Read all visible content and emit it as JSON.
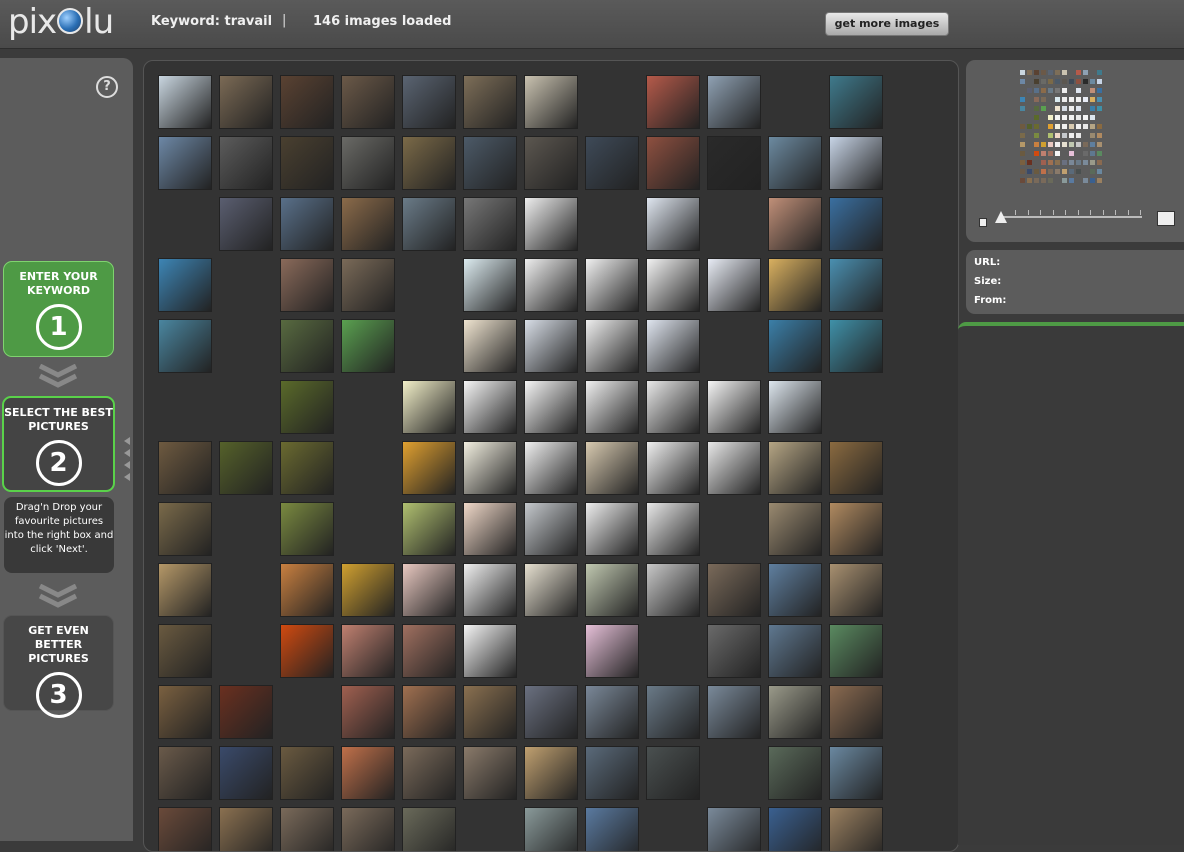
{
  "header": {
    "logo_left": "pix",
    "logo_right": "lu",
    "keyword_label": "Keyword: travail",
    "separator": "|",
    "count_label": "146 images loaded",
    "more_button": "get more images"
  },
  "sidebar": {
    "help": "?",
    "step1": {
      "label": "ENTER YOUR KEYWORD",
      "num": "1"
    },
    "step2": {
      "label": "SELECT THE BEST PICTURES",
      "num": "2"
    },
    "info": "Drag'n Drop your favourite pictures into the right box and click 'Next'.",
    "step3": {
      "label": "GET EVEN BETTER PICTURES",
      "num": "3"
    }
  },
  "details": {
    "url_label": "URL:",
    "size_label": "Size:",
    "from_label": "From:"
  },
  "colors": {
    "accent_green": "#4e9a45",
    "step_border": "#5ad24a"
  },
  "thumbnails": [
    [
      "#c9d6e0",
      "#7b6a55",
      "#5a4232",
      "#6b5948",
      "#5a6472",
      "#7d6e58",
      "#c9c2b0",
      "",
      "#b55a4a",
      "#8fa1b3",
      "",
      "#3f7a8c"
    ],
    [
      "#6d88a6",
      "#5c5c5c",
      "#4a4030",
      "#6a6a66",
      "#7b6a48",
      "#4c5a68",
      "#5c5750",
      "#3e4a58",
      "#8e5040",
      "#2a2a2a",
      "#6c8aa0",
      "#c7d4e6"
    ],
    [
      "",
      "#5a5e70",
      "#59708a",
      "#8b6b4a",
      "#6a7b88",
      "#777",
      "#eee",
      "",
      "#dfe6f0",
      "",
      "#c08f78",
      "#3a6fa0"
    ],
    [
      "#3d85b5",
      "",
      "#8a6a5a",
      "#7a6a58",
      "",
      "#dcebf0",
      "#eee",
      "#f0f0f0",
      "#f2f2f2",
      "#e8ecf5",
      "#d9b060",
      "#4a8fb0"
    ],
    [
      "#4a86a0",
      "",
      "#586a40",
      "#5aa050",
      "",
      "#efe4d0",
      "#d7dde6",
      "#eee",
      "#dfe5ef",
      "",
      "#3b7fa8",
      "#3f90a8"
    ],
    [
      "",
      "",
      "#5a6a2a",
      "",
      "#f2efc8",
      "#f5f5f5",
      "#f5f5f5",
      "#f0f0f0",
      "#e8e8e8",
      "#f5f5f5",
      "#dde6ee",
      ""
    ],
    [
      "#6e5a40",
      "#55612a",
      "#6a6a30",
      "",
      "#e0a030",
      "#f2efe0",
      "#f0f0f0",
      "#d8cab0",
      "#f0f0f0",
      "#e8e8e8",
      "#b5a584",
      "#8a6a40"
    ],
    [
      "#7a6a4a",
      "",
      "#7a8a40",
      "",
      "#b0c070",
      "#f0d8c8",
      "#c4c8cc",
      "#eee",
      "#e8e8e8",
      "",
      "#9a8a70",
      "#b08a60"
    ],
    [
      "#b59868",
      "",
      "#c98040",
      "#d0a030",
      "#e8c8c0",
      "#f0f0f0",
      "#e6e0d0",
      "#c0c8b0",
      "#c8c8c8",
      "#7a6a5a",
      "#5f7f9f",
      "#a89070"
    ],
    [
      "#6a5a40",
      "",
      "#d04a10",
      "#c08070",
      "#a07060",
      "#f5f5f5",
      "",
      "#e6c0d8",
      "",
      "#6a6a6a",
      "#5f7890",
      "#5a8a60"
    ],
    [
      "#7a6040",
      "#6a3020",
      "",
      "#a06050",
      "#a07050",
      "#8a7050",
      "#6a7080",
      "#7a8898",
      "#6a7a88",
      "#7a8a9a",
      "#9a9a8a",
      "#8a6a50"
    ],
    [
      "#6a5a4a",
      "#3a4a6a",
      "#6a5a40",
      "#c0704a",
      "#7a6a5a",
      "#8a7a6a",
      "#c0a070",
      "#5a6a7a",
      "#4a5050",
      "",
      "#5a6a5a",
      "#6a88a0"
    ],
    [
      "#6a4a3a",
      "#8a7050",
      "#7a6a5a",
      "#7a6a5a",
      "#6a6a5a",
      "",
      "#8a9a9a",
      "#5a7aa0",
      "",
      "#7a8a9a",
      "#3a6090",
      "#9a8060"
    ]
  ]
}
